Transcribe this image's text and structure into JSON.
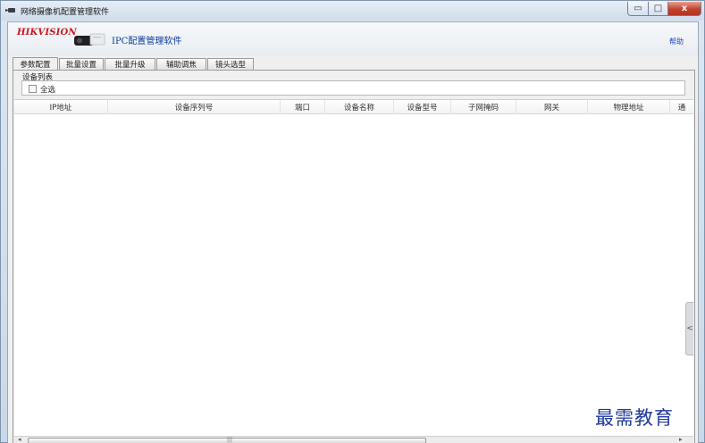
{
  "window": {
    "title": "网络摄像机配置管理软件",
    "controls": {
      "minimize": "▭",
      "maximize": "□",
      "close": "x"
    }
  },
  "header": {
    "logo": "HIKVISION",
    "app_title": "IPC配置管理软件",
    "help": "帮助"
  },
  "tabs": [
    {
      "label": "参数配置",
      "active": true
    },
    {
      "label": "批量设置",
      "active": false
    },
    {
      "label": "批量升级",
      "active": false
    },
    {
      "label": "辅助调焦",
      "active": false
    },
    {
      "label": "镜头选型",
      "active": false
    }
  ],
  "device_list": {
    "group_label": "设备列表",
    "select_all": "全选",
    "columns": [
      "IP地址",
      "设备序列号",
      "端口",
      "设备名称",
      "设备型号",
      "子网掩码",
      "网关",
      "物理地址",
      "通"
    ],
    "rows": []
  },
  "scroll": {
    "left": "◂",
    "right": "▸",
    "grip": "|||",
    "side_toggle": "<"
  },
  "watermark": "最需教育",
  "colors": {
    "logo": "#c8161d",
    "title": "#0a3a9e",
    "close_button": "#c3412e"
  }
}
